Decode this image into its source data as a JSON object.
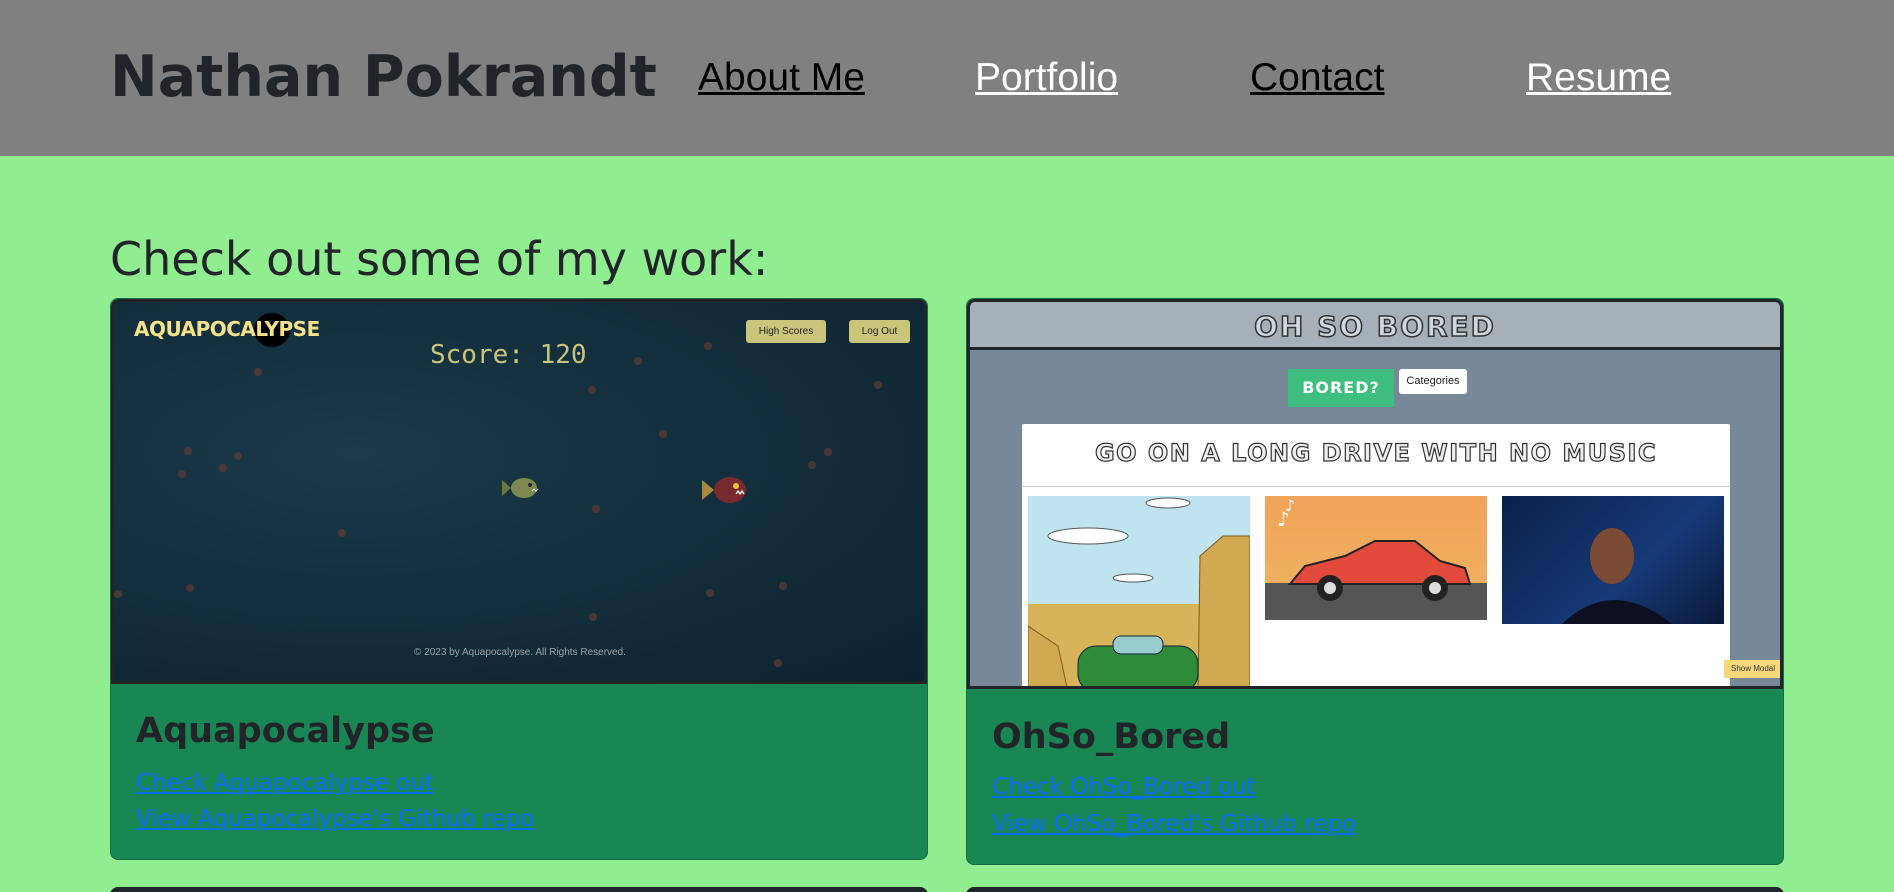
{
  "header": {
    "brand": "Nathan Pokrandt",
    "nav": [
      "About Me",
      "Portfolio",
      "Contact",
      "Resume"
    ]
  },
  "main": {
    "heading": "Check out some of my work:",
    "projects": [
      {
        "title": "Aquapocalypse",
        "links": [
          "Check Aquapocalypse out",
          "View Aquapocalypse's Github repo"
        ],
        "preview": {
          "logo": "AQUAPOCALYPSE",
          "score": "Score: 120",
          "buttons": [
            "High Scores",
            "Log Out"
          ],
          "footer": "© 2023 by Aquapocalypse. All Rights Reserved."
        }
      },
      {
        "title": "OhSo_Bored",
        "links": [
          "Check OhSo_Bored out",
          "View OhSo_Bored's Github repo"
        ],
        "preview": {
          "site_title": "OH SO BORED",
          "bored_button": "BORED?",
          "categories_button": "Categories",
          "activity": "GO ON A LONG DRIVE WITH NO MUSIC",
          "modal_button": "Show Modal"
        }
      }
    ]
  },
  "colors": {
    "header_bg": "#808080",
    "page_bg": "#90ee90",
    "card_bg": "#198754",
    "link": "#0d6efd"
  }
}
